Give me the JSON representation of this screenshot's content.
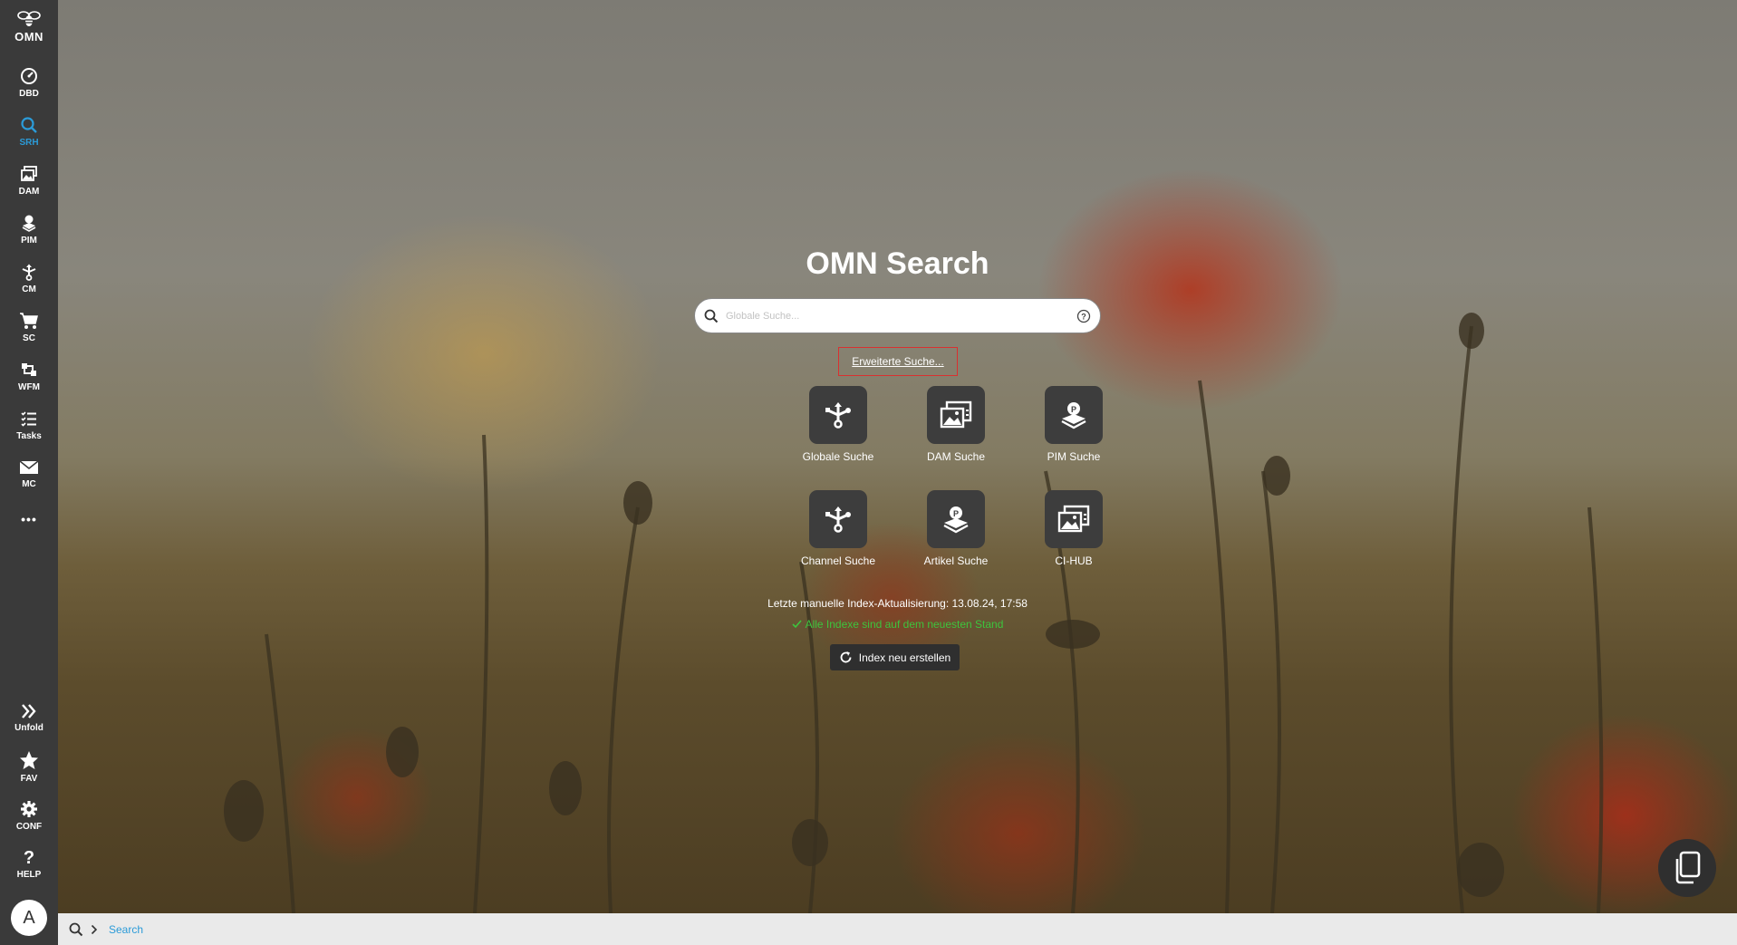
{
  "app": {
    "logo_text": "OMN"
  },
  "sidebar": {
    "items": [
      {
        "label": "DBD",
        "icon": "dashboard-icon"
      },
      {
        "label": "SRH",
        "icon": "search-icon",
        "active": true
      },
      {
        "label": "DAM",
        "icon": "image-gallery-icon"
      },
      {
        "label": "PIM",
        "icon": "pim-icon"
      },
      {
        "label": "CM",
        "icon": "channel-icon"
      },
      {
        "label": "SC",
        "icon": "cart-icon"
      },
      {
        "label": "WFM",
        "icon": "workflow-icon"
      },
      {
        "label": "Tasks",
        "icon": "tasks-icon"
      },
      {
        "label": "MC",
        "icon": "mail-icon"
      }
    ],
    "more_label": "•••",
    "bottom_items": [
      {
        "label": "Unfold",
        "icon": "double-chevron-right-icon"
      },
      {
        "label": "FAV",
        "icon": "star-icon"
      },
      {
        "label": "CONF",
        "icon": "gear-icon"
      },
      {
        "label": "HELP",
        "icon": "question-icon"
      }
    ],
    "avatar_initial": "A"
  },
  "main": {
    "title": "OMN Search",
    "search_placeholder": "Globale Suche...",
    "advanced_search_label": "Erweiterte Suche...",
    "tiles": [
      {
        "label": "Globale Suche",
        "icon": "global-search-icon"
      },
      {
        "label": "DAM Suche",
        "icon": "dam-icon"
      },
      {
        "label": "PIM Suche",
        "icon": "pim-icon"
      },
      {
        "label": "Channel Suche",
        "icon": "channel-icon"
      },
      {
        "label": "Artikel Suche",
        "icon": "article-icon"
      },
      {
        "label": "CI-HUB",
        "icon": "ci-hub-icon"
      }
    ],
    "index_info": "Letzte manuelle Index-Aktualisierung: 13.08.24, 17:58",
    "index_status": "Alle Indexe sind auf dem neuesten Stand",
    "rebuild_label": "Index neu erstellen"
  },
  "breadcrumb": {
    "current": "Search"
  },
  "colors": {
    "sidebar_bg": "#3a3a3a",
    "accent": "#2b9bd8",
    "status_ok": "#3dc43d",
    "highlight_border": "#d93030"
  }
}
